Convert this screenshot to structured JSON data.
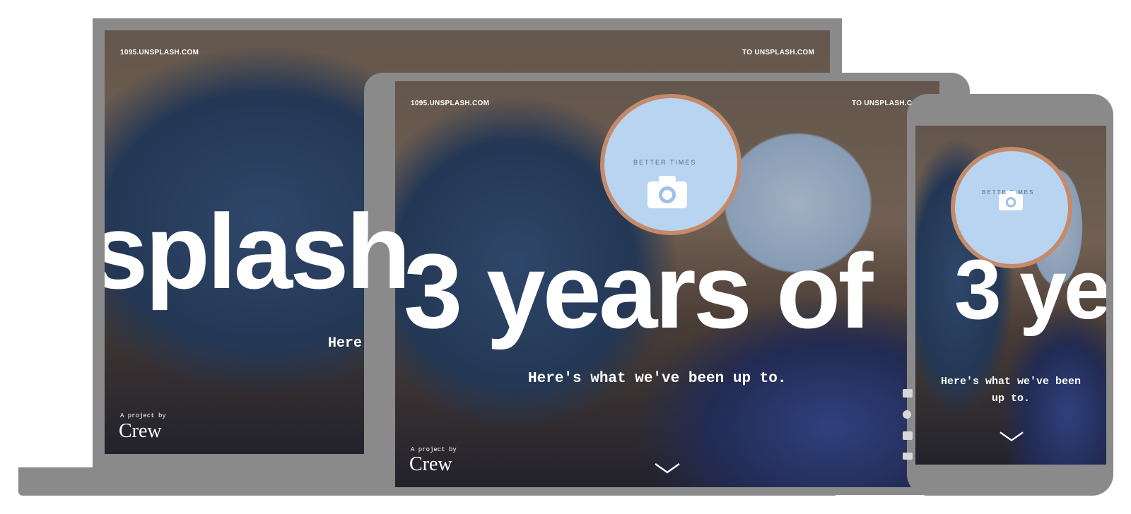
{
  "site": {
    "left_link": "1095.UNSPLASH.COM",
    "right_link": "TO UNSPLASH.COM",
    "right_link_truncated": "TO UNSPLASH.C",
    "project_by": "A project by",
    "crew": "Crew",
    "watch_text": "BETTER TIMES",
    "watch_text_partial": "BETTE TIMES"
  },
  "laptop": {
    "headline": "splash",
    "subline_partial": "Here"
  },
  "tablet": {
    "headline": "3 years of",
    "subline": "Here's what we've been up to."
  },
  "phone": {
    "headline": "3 ye",
    "subline_line1": "Here's what we've been",
    "subline_line2": "up to."
  },
  "colors": {
    "frame": "#8a8a8a",
    "text": "#ffffff"
  },
  "icons": [
    "camera-icon",
    "chevron-down-icon",
    "social-icons"
  ]
}
